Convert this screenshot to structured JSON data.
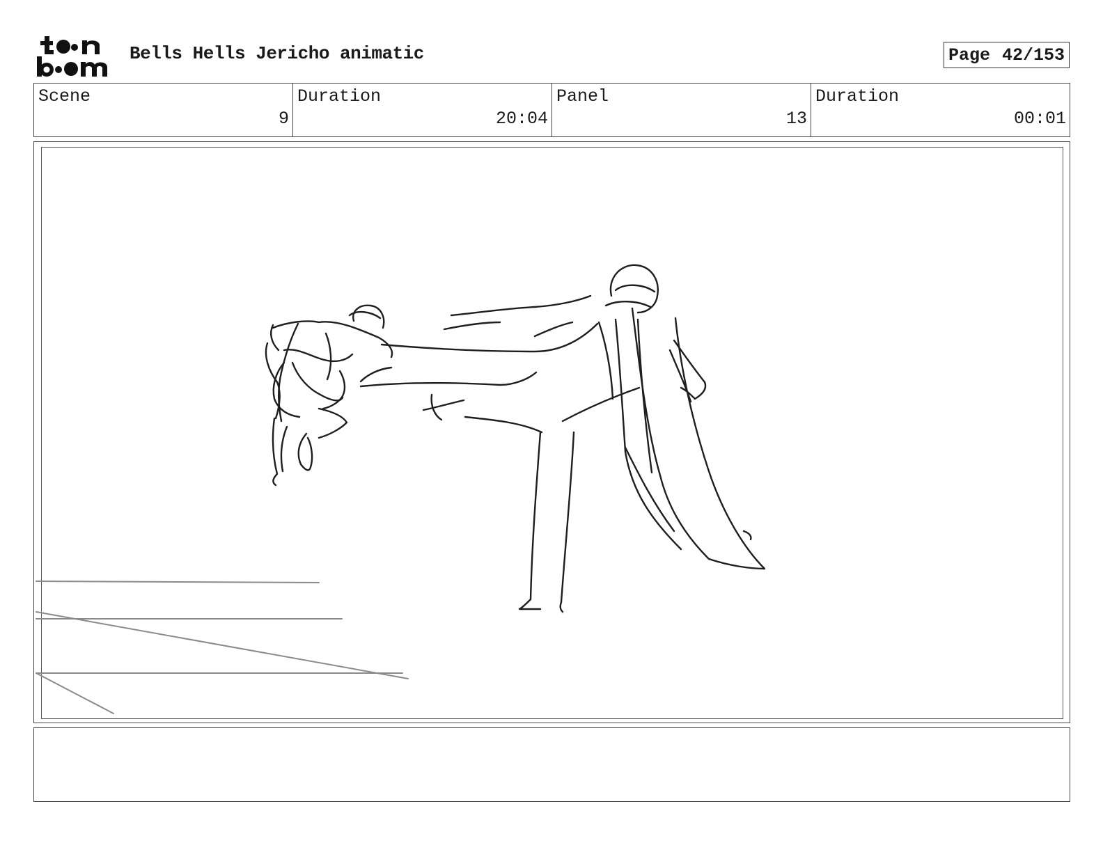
{
  "header": {
    "title": "Bells Hells Jericho animatic",
    "page_label": "Page",
    "page_number": "42/153",
    "logo_text": "toon boom"
  },
  "info": [
    {
      "label": "Scene",
      "value": "9"
    },
    {
      "label": "Duration",
      "value": "20:04"
    },
    {
      "label": "Panel",
      "value": "13"
    },
    {
      "label": "Duration",
      "value": "00:01"
    }
  ],
  "notes": {
    "text": ""
  }
}
